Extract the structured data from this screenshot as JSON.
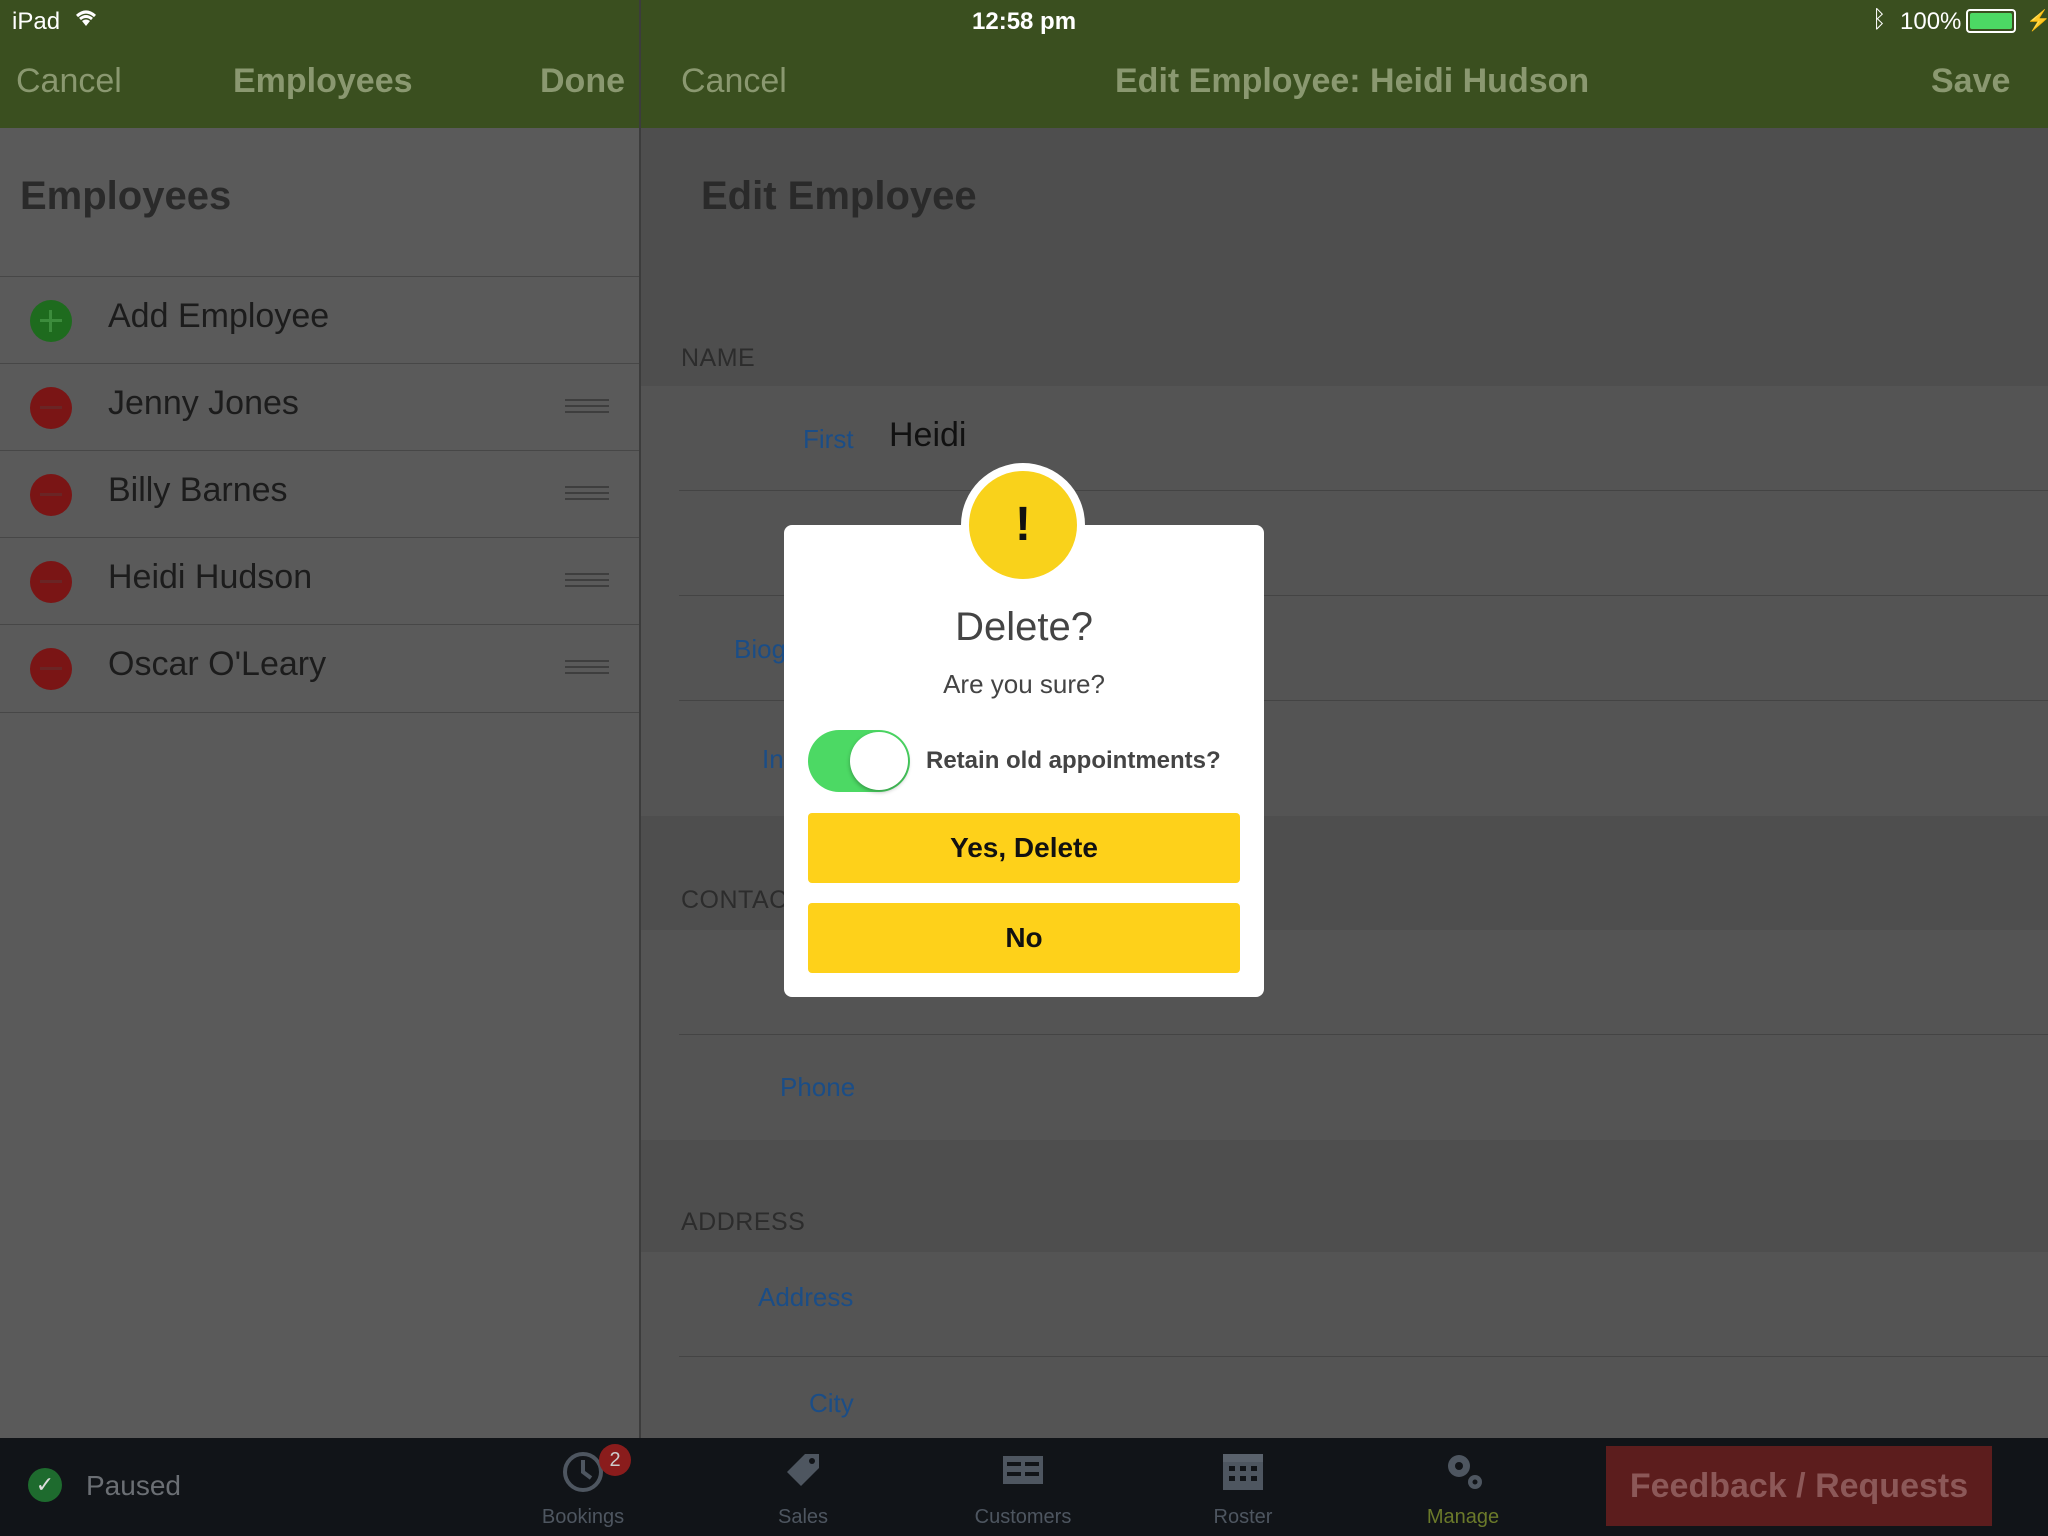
{
  "status_bar": {
    "device": "iPad",
    "time": "12:58 pm",
    "battery": "100%"
  },
  "left_nav": {
    "cancel": "Cancel",
    "title": "Employees",
    "done": "Done"
  },
  "right_nav": {
    "cancel": "Cancel",
    "title": "Edit Employee: Heidi Hudson",
    "save": "Save"
  },
  "left_pane": {
    "heading": "Employees",
    "add_label": "Add Employee",
    "employees": [
      "Jenny Jones",
      "Billy Barnes",
      "Heidi Hudson",
      "Oscar O'Leary"
    ]
  },
  "right_pane": {
    "heading": "Edit Employee",
    "name_section": "NAME",
    "first_label": "First",
    "first_value": "Heidi",
    "bio_label_partial": "Biog",
    "in_label_partial": "In",
    "contact_section_partial": "CONTAC",
    "phone_label": "Phone",
    "address_section": "ADDRESS",
    "address_label": "Address",
    "city_label": "City"
  },
  "tab_bar": {
    "status": "Paused",
    "bookings": "Bookings",
    "bookings_badge": "2",
    "sales": "Sales",
    "customers": "Customers",
    "roster": "Roster",
    "manage": "Manage",
    "feedback": "Feedback / Requests"
  },
  "dialog": {
    "icon": "!",
    "title": "Delete?",
    "message": "Are you sure?",
    "toggle_label": "Retain old appointments?",
    "toggle_on": true,
    "yes_button": "Yes, Delete",
    "no_button": "No"
  },
  "colors": {
    "nav_bg": "#3a4f1f",
    "accent_yellow": "#fed11a",
    "toggle_green": "#4cd964",
    "feedback_red": "#5c1d1d",
    "manage_active": "#6b7a2a"
  }
}
